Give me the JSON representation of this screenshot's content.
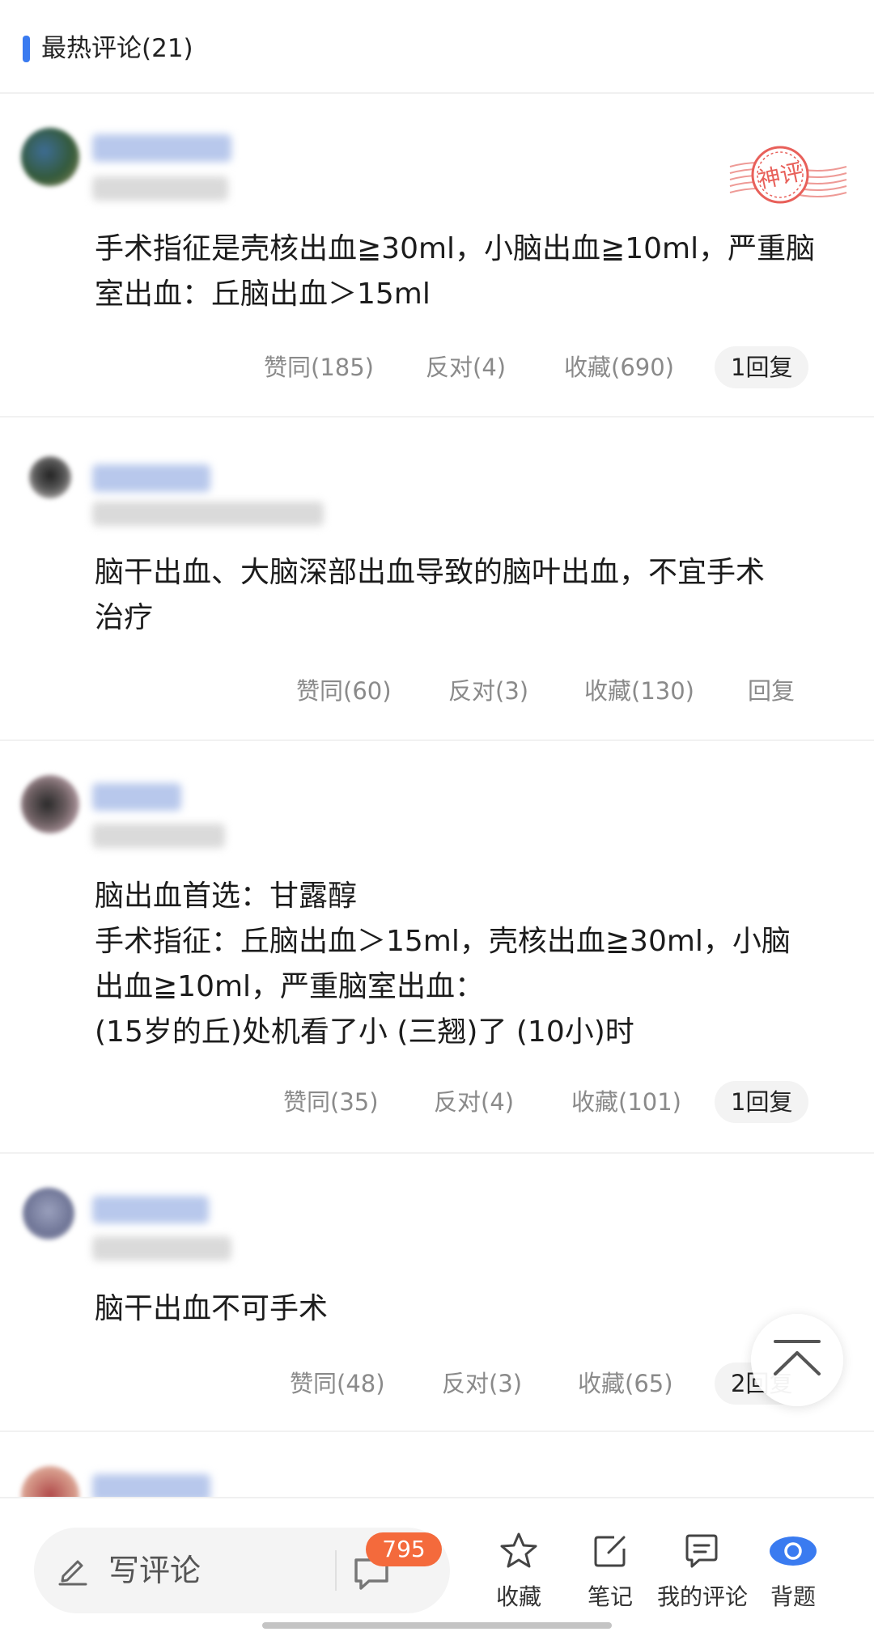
{
  "header": {
    "title": "最热评论(21)"
  },
  "stamp_text": "神评",
  "comments": [
    {
      "text": "手术指征是壳核出血≧30ml，小脑出血≧10ml，严重脑\n室出血：丘脑出血＞15ml",
      "agree": "赞同(185)",
      "oppose": "反对(4)",
      "collect": "收藏(690)",
      "reply": "1回复"
    },
    {
      "text": "脑干出血、大脑深部出血导致的脑叶出血，不宜手术\n治疗",
      "agree": "赞同(60)",
      "oppose": "反对(3)",
      "collect": "收藏(130)",
      "reply": "回复"
    },
    {
      "text": "脑出血首选：甘露醇\n手术指征：丘脑出血＞15ml，壳核出血≧30ml，小脑\n出血≧10ml，严重脑室出血：\n(15岁的丘)处机看了小 (三翘)了 (10小)时",
      "agree": "赞同(35)",
      "oppose": "反对(4)",
      "collect": "收藏(101)",
      "reply": "1回复"
    },
    {
      "text": "脑干出血不可手术",
      "agree": "赞同(48)",
      "oppose": "反对(3)",
      "collect": "收藏(65)",
      "reply": "2回复"
    }
  ],
  "bottom": {
    "write_label": "写评论",
    "comment_count": "795",
    "tools": [
      "收藏",
      "笔记",
      "我的评论",
      "背题"
    ]
  },
  "colors": {
    "accent": "#3a7bf0",
    "badge": "#f46a3c",
    "stamp": "#e8605a"
  }
}
